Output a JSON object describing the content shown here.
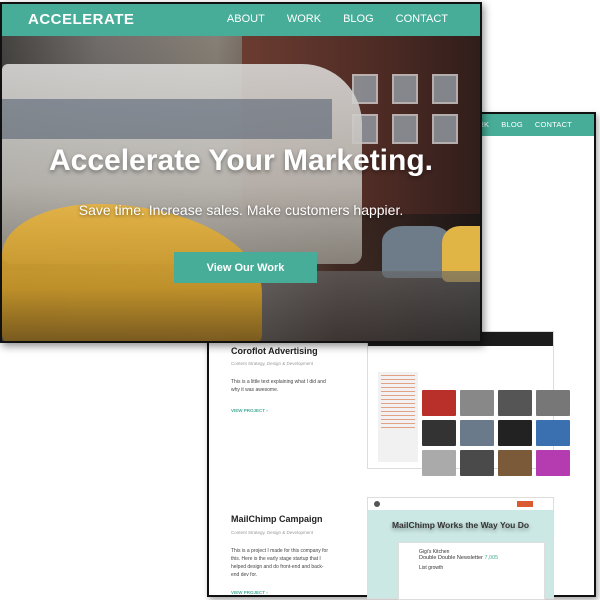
{
  "front": {
    "brand": "ACCELERATE",
    "nav": [
      "ABOUT",
      "WORK",
      "BLOG",
      "CONTACT"
    ],
    "hero": {
      "headline": "Accelerate Your Marketing.",
      "subheadline": "Save time. Increase sales. Make customers happier.",
      "cta_label": "View Our Work"
    }
  },
  "back": {
    "nav": [
      "WORK",
      "BLOG",
      "CONTACT"
    ],
    "projects": [
      {
        "title": "Coroflot Advertising",
        "meta": "Content Strategy, Design & Development",
        "description": "This is a little text explaining what I did and why it was awesome.",
        "link": "VIEW PROJECT ›"
      },
      {
        "title": "MailChimp Campaign",
        "meta": "Content Strategy, Design & Development",
        "description": "This is a project I made for this company for this. Here is the early stage startup that I helped design and do front-end and back-end dev for.",
        "link": "VIEW PROJECT ›"
      }
    ],
    "mailchimp_preview": {
      "headline": "MailChimp Works the Way You Do",
      "card_title": "Gigi's Kitchen",
      "card_heading": "Double Double Newsletter",
      "card_count": "7,005",
      "card_stat": "List growth"
    }
  },
  "colors": {
    "accent": "#47ad98"
  }
}
